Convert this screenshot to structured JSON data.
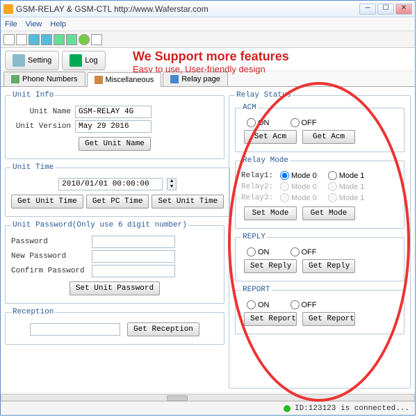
{
  "window": {
    "title": "GSM-RELAY & GSM-CTL      http://www.Waferstar.com"
  },
  "menu": {
    "file": "File",
    "view": "View",
    "help": "Help"
  },
  "toolbarBtns": {
    "setting": "Setting",
    "log": "Log"
  },
  "promo": {
    "line1": "We Support more features",
    "line2": "Easy to use, User-friendly design"
  },
  "tabs": {
    "phone": "Phone Numbers",
    "misc": "Miscellaneous",
    "relay": "Relay page"
  },
  "unitInfo": {
    "legend": "Unit Info",
    "name_lbl": "Unit Name",
    "name_val": "GSM-RELAY 4G",
    "ver_lbl": "Unit Version",
    "ver_val": "May 29 2016",
    "get_btn": "Get Unit Name"
  },
  "unitTime": {
    "legend": "Unit Time",
    "value": "2010/01/01 00:00:00",
    "get_unit": "Get Unit Time",
    "get_pc": "Get PC Time",
    "set": "Set Unit Time"
  },
  "pwd": {
    "legend": "Unit Password(Only use 6 digit number)",
    "p1": "Password",
    "p2": "New Password",
    "p3": "Confirm Password",
    "set": "Set Unit Password"
  },
  "reception": {
    "legend": "Reception",
    "get": "Get Reception"
  },
  "relayStatus": {
    "legend": "Relay Status",
    "acm": {
      "legend": "ACM",
      "on": "ON",
      "off": "OFF",
      "set": "Set Acm",
      "get": "Get Acm"
    },
    "mode": {
      "legend": "Relay Mode",
      "r1": "Relay1:",
      "r2": "Relay2:",
      "r3": "Relay3:",
      "m0": "Mode 0",
      "m1": "Mode 1",
      "set": "Set Mode",
      "get": "Get Mode"
    },
    "reply": {
      "legend": "REPLY",
      "on": "ON",
      "off": "OFF",
      "set": "Set Reply",
      "get": "Get Reply"
    },
    "report": {
      "legend": "REPORT",
      "on": "ON",
      "off": "OFF",
      "set": "Set Report",
      "get": "Get Report"
    }
  },
  "status": {
    "text": "ID:123123 is connected..."
  }
}
